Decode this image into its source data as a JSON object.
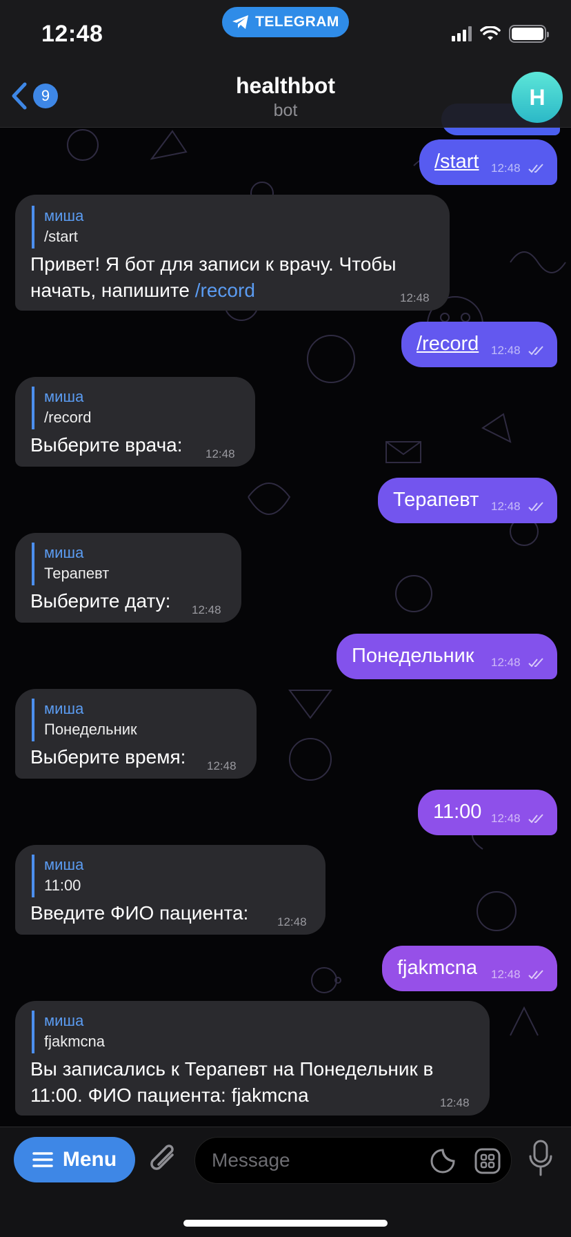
{
  "status": {
    "time": "12:48",
    "app_pill": "TELEGRAM"
  },
  "header": {
    "back_count": "9",
    "title": "healthbot",
    "subtitle": "bot",
    "avatar_letter": "H"
  },
  "messages": [
    {
      "dir": "out",
      "text": "/start",
      "time": "12:48",
      "read": true
    },
    {
      "dir": "in",
      "reply_name": "миша",
      "reply_text": "/start",
      "text_line1": "Привет! Я бот для записи к врачу. Чтобы",
      "text_line2_prefix": "начать, напишите ",
      "text_line2_link": "/record",
      "time": "12:48"
    },
    {
      "dir": "out",
      "text": "/record",
      "time": "12:48",
      "read": true
    },
    {
      "dir": "in",
      "reply_name": "миша",
      "reply_text": "/record",
      "text": "Выберите врача:",
      "time": "12:48"
    },
    {
      "dir": "out",
      "text": "Терапевт",
      "time": "12:48",
      "read": true
    },
    {
      "dir": "in",
      "reply_name": "миша",
      "reply_text": "Терапевт",
      "text": "Выберите дату:",
      "time": "12:48"
    },
    {
      "dir": "out",
      "text": "Понедельник",
      "time": "12:48",
      "read": true
    },
    {
      "dir": "in",
      "reply_name": "миша",
      "reply_text": "Понедельник",
      "text": "Выберите время:",
      "time": "12:48"
    },
    {
      "dir": "out",
      "text": "11:00",
      "time": "12:48",
      "read": true
    },
    {
      "dir": "in",
      "reply_name": "миша",
      "reply_text": "11:00",
      "text": "Введите ФИО пациента:",
      "time": "12:48"
    },
    {
      "dir": "out",
      "text": "fjakmcna",
      "time": "12:48",
      "read": true
    },
    {
      "dir": "in",
      "reply_name": "миша",
      "reply_text": "fjakmcna",
      "text_line1": "Вы записались к Терапевт на Понедельник в",
      "text_line2": "11:00. ФИО пациента: fjakmcna",
      "time": "12:48"
    }
  ],
  "composer": {
    "menu_label": "Menu",
    "placeholder": "Message"
  },
  "colors": {
    "accent": "#3e87e6",
    "outgoing_top": "#5a5cf0",
    "outgoing_bottom": "#9a4fe8",
    "incoming": "#2a2a2e"
  },
  "icons": [
    "telegram-icon",
    "signal-icon",
    "wifi-icon",
    "battery-icon",
    "back-chevron-icon",
    "hamburger-icon",
    "paperclip-icon",
    "sticker-icon",
    "command-grid-icon",
    "microphone-icon",
    "double-check-icon"
  ]
}
